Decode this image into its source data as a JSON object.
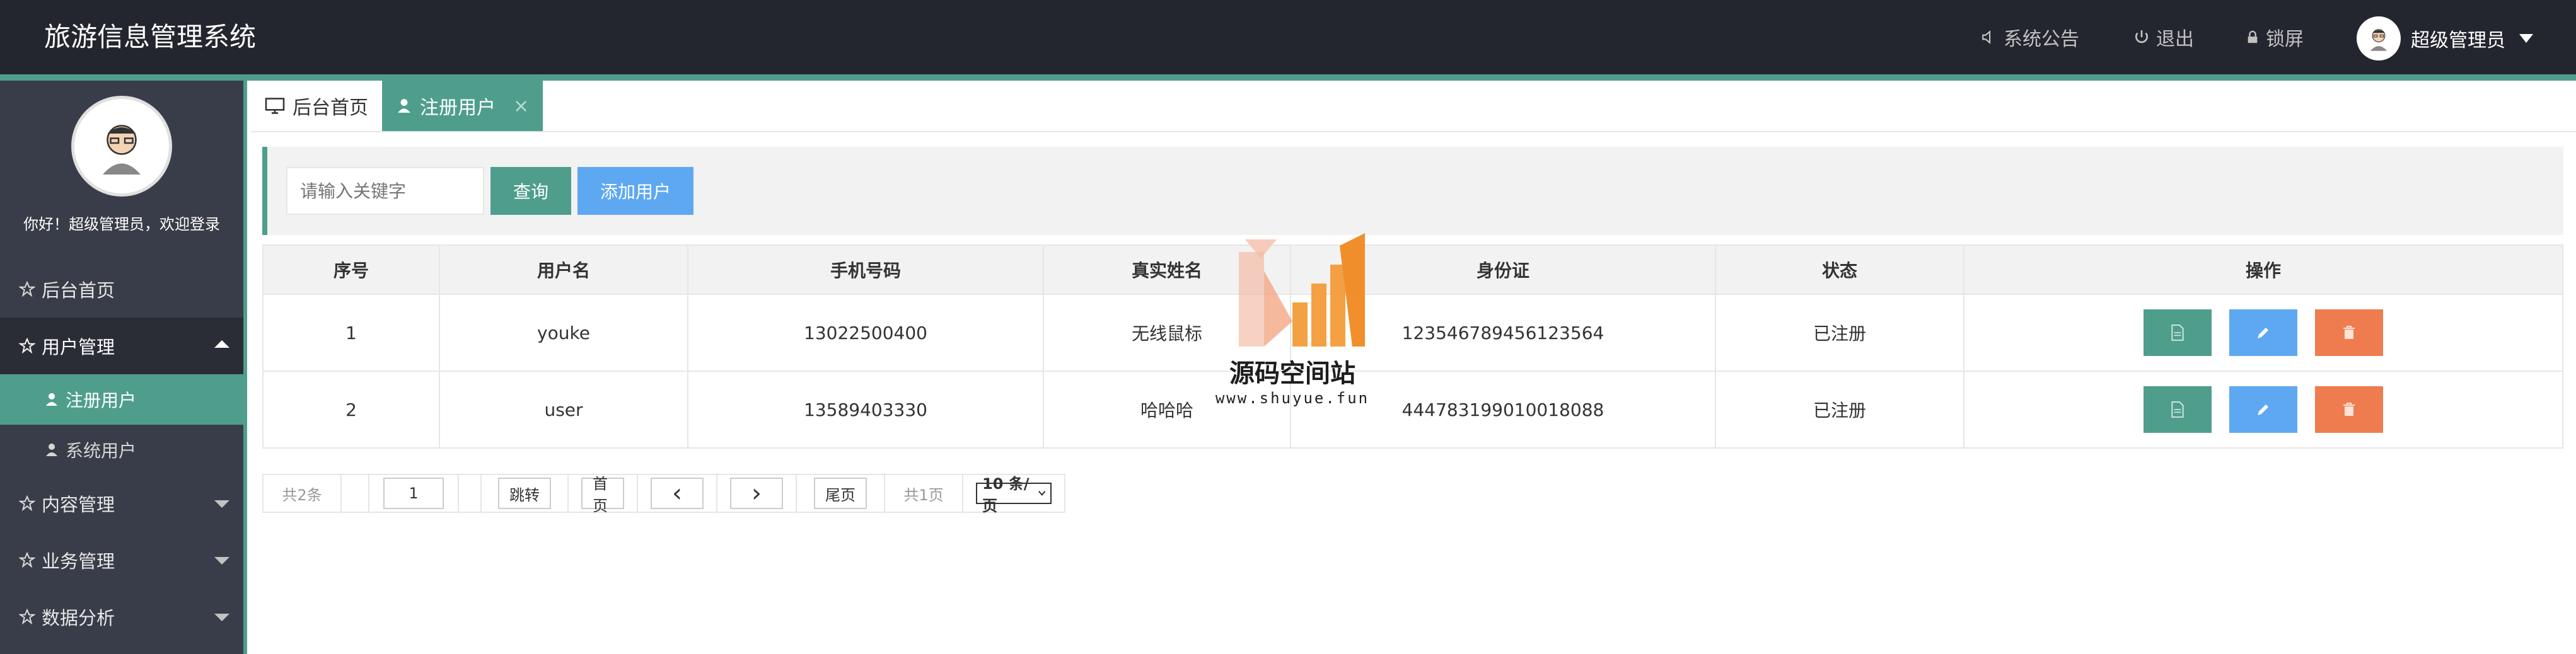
{
  "app": {
    "title": "旅游信息管理系统"
  },
  "header": {
    "announcement": "系统公告",
    "logout": "退出",
    "lock": "锁屏",
    "user": "超级管理员"
  },
  "sidebar": {
    "welcome": "你好！超级管理员，欢迎登录",
    "items": [
      {
        "label": "后台首页"
      },
      {
        "label": "用户管理"
      },
      {
        "label": "注册用户"
      },
      {
        "label": "系统用户"
      },
      {
        "label": "内容管理"
      },
      {
        "label": "业务管理"
      },
      {
        "label": "数据分析"
      }
    ]
  },
  "tabs": [
    {
      "label": "后台首页"
    },
    {
      "label": "注册用户",
      "close": "×"
    }
  ],
  "toolbar": {
    "search_placeholder": "请输入关键字",
    "query": "查询",
    "add": "添加用户"
  },
  "table": {
    "headers": [
      "序号",
      "用户名",
      "手机号码",
      "真实姓名",
      "身份证",
      "状态",
      "操作"
    ],
    "rows": [
      [
        "1",
        "youke",
        "13022500400",
        "无线鼠标",
        "123546789456123564",
        "已注册"
      ],
      [
        "2",
        "user",
        "13589403330",
        "哈哈哈",
        "444783199010018088",
        "已注册"
      ]
    ]
  },
  "pager": {
    "total": "共2条",
    "page": "1",
    "jump": "跳转",
    "first": "首页",
    "prev": "‹",
    "next": "›",
    "last": "尾页",
    "pages": "共1页",
    "per_page": "10 条/页"
  },
  "watermark": {
    "title": "源码空间站",
    "url": "www.shuyue.fun"
  },
  "colors": {
    "accent": "#4f9e8c",
    "header_bg": "#23262e",
    "sidebar_bg": "#393d49",
    "blue": "#5ea8f2",
    "red": "#ef7c4f"
  }
}
